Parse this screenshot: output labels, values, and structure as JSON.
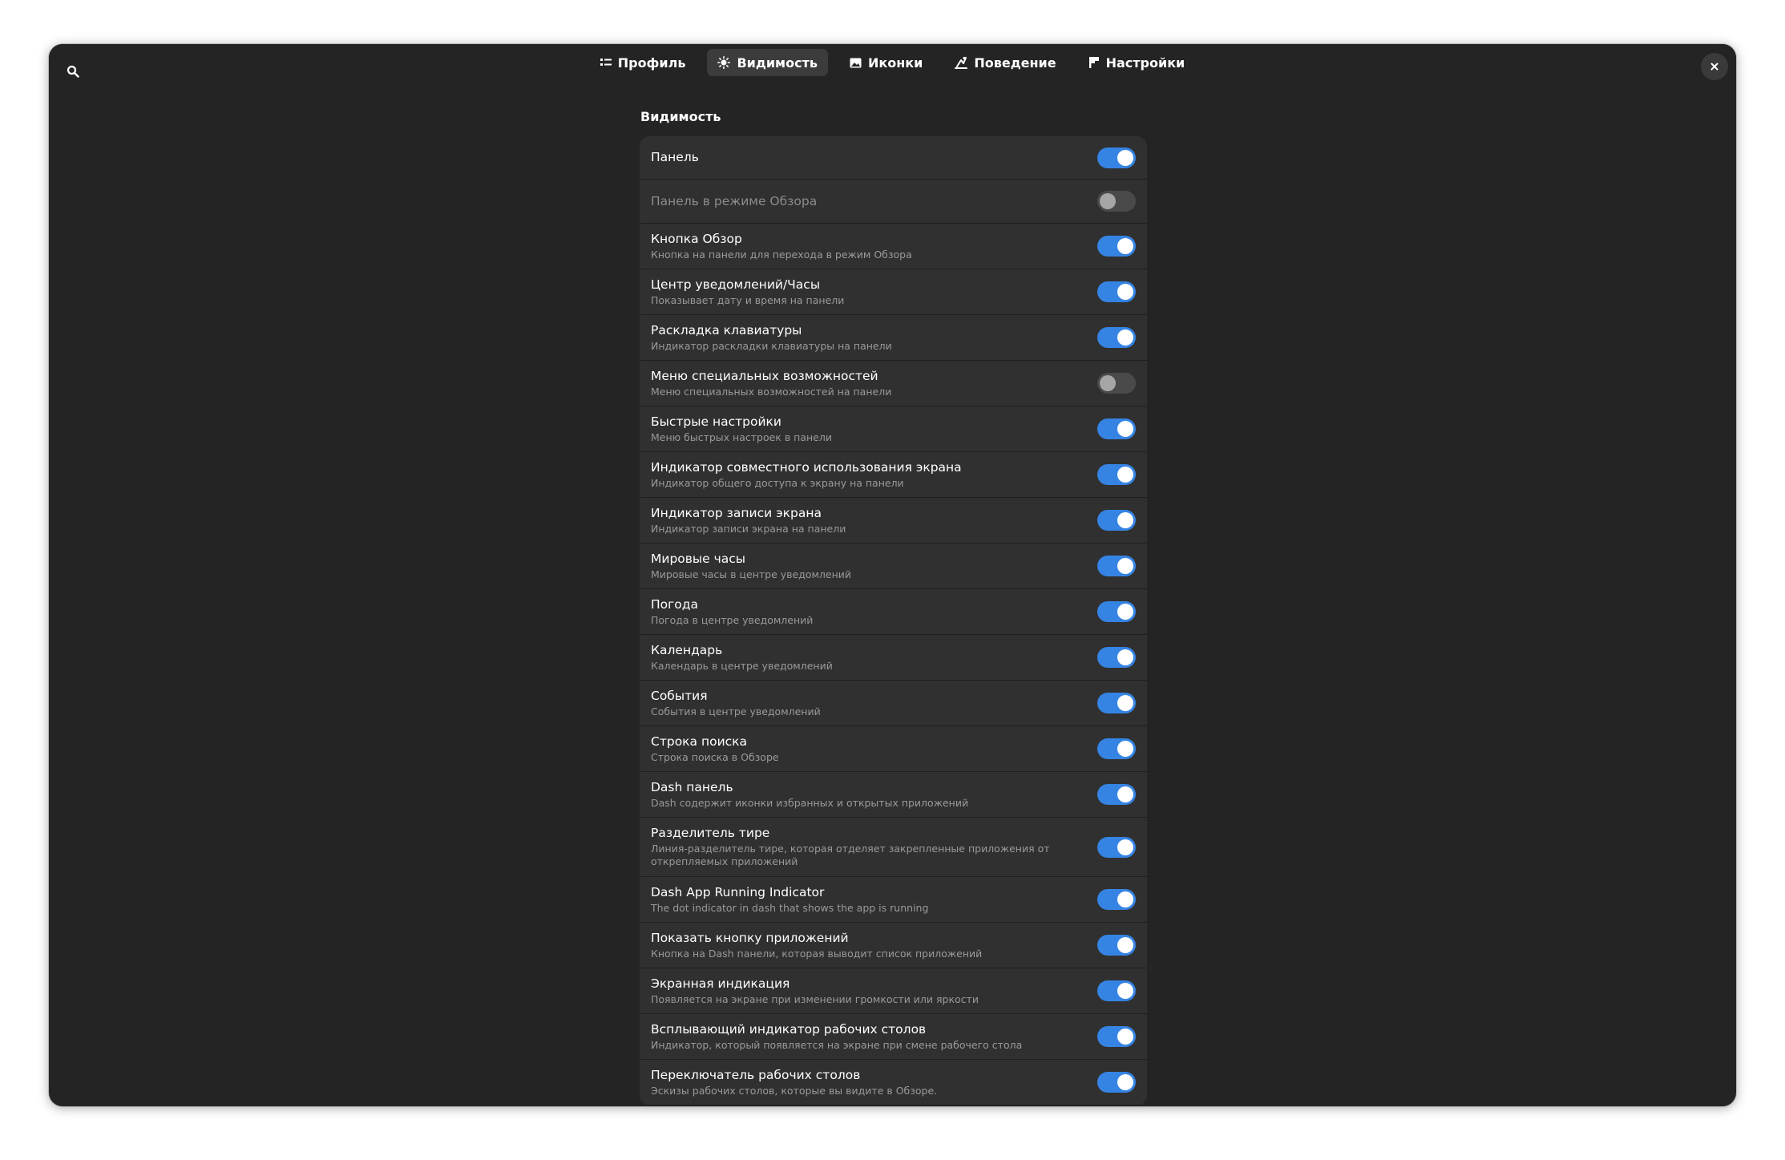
{
  "tabs": [
    {
      "label": "Профиль",
      "icon": "profile-icon",
      "active": false
    },
    {
      "label": "Видимость",
      "icon": "sun-icon",
      "active": true
    },
    {
      "label": "Иконки",
      "icon": "image-icon",
      "active": false
    },
    {
      "label": "Поведение",
      "icon": "behavior-icon",
      "active": false
    },
    {
      "label": "Настройки",
      "icon": "settings-flag-icon",
      "active": false
    }
  ],
  "colors": {
    "accent": "#3584e4",
    "window_bg": "#242424",
    "list_bg": "#303030"
  },
  "section_title": "Видимость",
  "rows": [
    {
      "title": "Панель",
      "subtitle": "",
      "on": true,
      "enabled": true
    },
    {
      "title": "Панель в режиме Обзора",
      "subtitle": "",
      "on": false,
      "enabled": false
    },
    {
      "title": "Кнопка Обзор",
      "subtitle": "Кнопка на панели для перехода в режим Обзора",
      "on": true,
      "enabled": true
    },
    {
      "title": "Центр уведомлений/Часы",
      "subtitle": "Показывает дату и время на панели",
      "on": true,
      "enabled": true
    },
    {
      "title": "Раскладка клавиатуры",
      "subtitle": "Индикатор раскладки клавиатуры на панели",
      "on": true,
      "enabled": true
    },
    {
      "title": "Меню специальных возможностей",
      "subtitle": "Меню специальных возможностей на панели",
      "on": false,
      "enabled": true
    },
    {
      "title": "Быстрые настройки",
      "subtitle": "Меню быстрых настроек в панели",
      "on": true,
      "enabled": true
    },
    {
      "title": "Индикатор совместного использования экрана",
      "subtitle": "Индикатор общего доступа к экрану на панели",
      "on": true,
      "enabled": true
    },
    {
      "title": "Индикатор записи экрана",
      "subtitle": "Индикатор записи экрана на панели",
      "on": true,
      "enabled": true
    },
    {
      "title": "Мировые часы",
      "subtitle": "Мировые часы в центре уведомлений",
      "on": true,
      "enabled": true
    },
    {
      "title": "Погода",
      "subtitle": "Погода в центре уведомлений",
      "on": true,
      "enabled": true
    },
    {
      "title": "Календарь",
      "subtitle": "Календарь в центре уведомлений",
      "on": true,
      "enabled": true
    },
    {
      "title": "События",
      "subtitle": "События в центре уведомлений",
      "on": true,
      "enabled": true
    },
    {
      "title": "Строка поиска",
      "subtitle": "Строка поиска в Обзоре",
      "on": true,
      "enabled": true
    },
    {
      "title": "Dash панель",
      "subtitle": "Dash содержит иконки избранных и открытых приложений",
      "on": true,
      "enabled": true
    },
    {
      "title": "Разделитель тире",
      "subtitle": "Линия-разделитель тире, которая отделяет закрепленные приложения от открепляемых приложений",
      "on": true,
      "enabled": true
    },
    {
      "title": "Dash App Running Indicator",
      "subtitle": "The dot indicator in dash that shows the app is running",
      "on": true,
      "enabled": true
    },
    {
      "title": "Показать кнопку приложений",
      "subtitle": "Кнопка на Dash панели, которая выводит список приложений",
      "on": true,
      "enabled": true
    },
    {
      "title": "Экранная индикация",
      "subtitle": "Появляется на экране при изменении громкости или яркости",
      "on": true,
      "enabled": true
    },
    {
      "title": "Всплывающий индикатор рабочих столов",
      "subtitle": "Индикатор, который появляется на экране при смене рабочего стола",
      "on": true,
      "enabled": true
    },
    {
      "title": "Переключатель рабочих столов",
      "subtitle": "Эскизы рабочих столов, которые вы видите в Обзоре.",
      "on": true,
      "enabled": true
    }
  ]
}
